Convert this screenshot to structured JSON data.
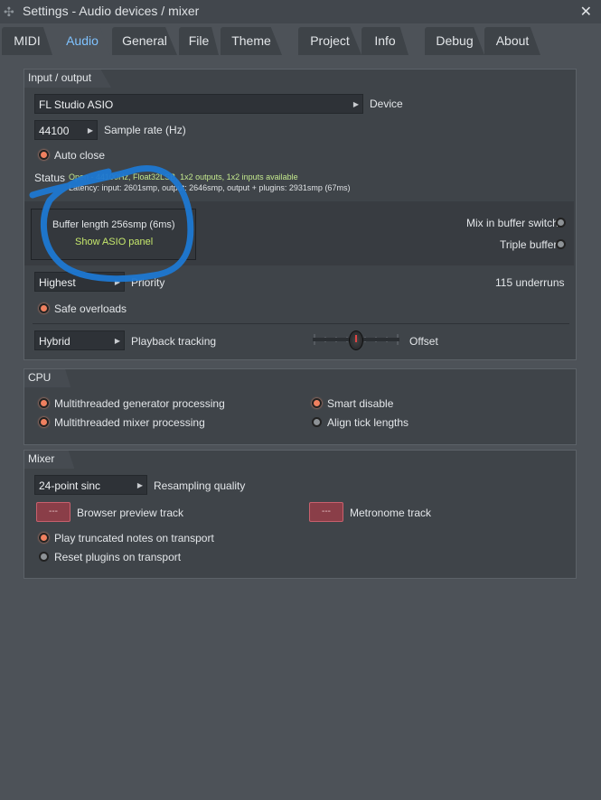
{
  "window": {
    "title": "Settings - Audio devices / mixer"
  },
  "tabs": [
    {
      "label": "MIDI"
    },
    {
      "label": "Audio"
    },
    {
      "label": "General"
    },
    {
      "label": "File"
    },
    {
      "label": "Theme"
    },
    {
      "label": "Project"
    },
    {
      "label": "Info"
    },
    {
      "label": "Debug"
    },
    {
      "label": "About"
    }
  ],
  "io": {
    "title": "Input / output",
    "device_value": "FL Studio ASIO",
    "device_label": "Device",
    "sample_rate_value": "44100",
    "sample_rate_label": "Sample rate (Hz)",
    "auto_close": "Auto close",
    "status_label": "Status",
    "status_line1": "Open - 44100Hz, Float32LSB, 1x2 outputs, 1x2 inputs available",
    "status_line2": "Latency: input: 2601smp, output: 2646smp, output + plugins: 2931smp (67ms)",
    "buffer_length": "Buffer length 256smp (6ms)",
    "show_asio": "Show ASIO panel",
    "mix_switch": "Mix in buffer switch",
    "triple_buffer": "Triple buffer",
    "priority_value": "Highest",
    "priority_label": "Priority",
    "underruns": "115 underruns",
    "safe_overloads": "Safe overloads",
    "tracking_value": "Hybrid",
    "tracking_label": "Playback tracking",
    "offset_label": "Offset"
  },
  "cpu": {
    "title": "CPU",
    "mt_gen": "Multithreaded generator processing",
    "mt_mix": "Multithreaded mixer processing",
    "smart_disable": "Smart disable",
    "align_tick": "Align tick lengths"
  },
  "mixer": {
    "title": "Mixer",
    "resample_value": "24-point sinc",
    "resample_label": "Resampling quality",
    "browser_btn": "---",
    "browser_label": "Browser preview track",
    "metro_btn": "---",
    "metro_label": "Metronome track",
    "play_truncated": "Play truncated notes on transport",
    "reset_plugins": "Reset plugins on transport"
  },
  "colors": {
    "accent": "#7fc2ff",
    "radio_on": "#f0805f",
    "annotation": "#1e78d2"
  }
}
